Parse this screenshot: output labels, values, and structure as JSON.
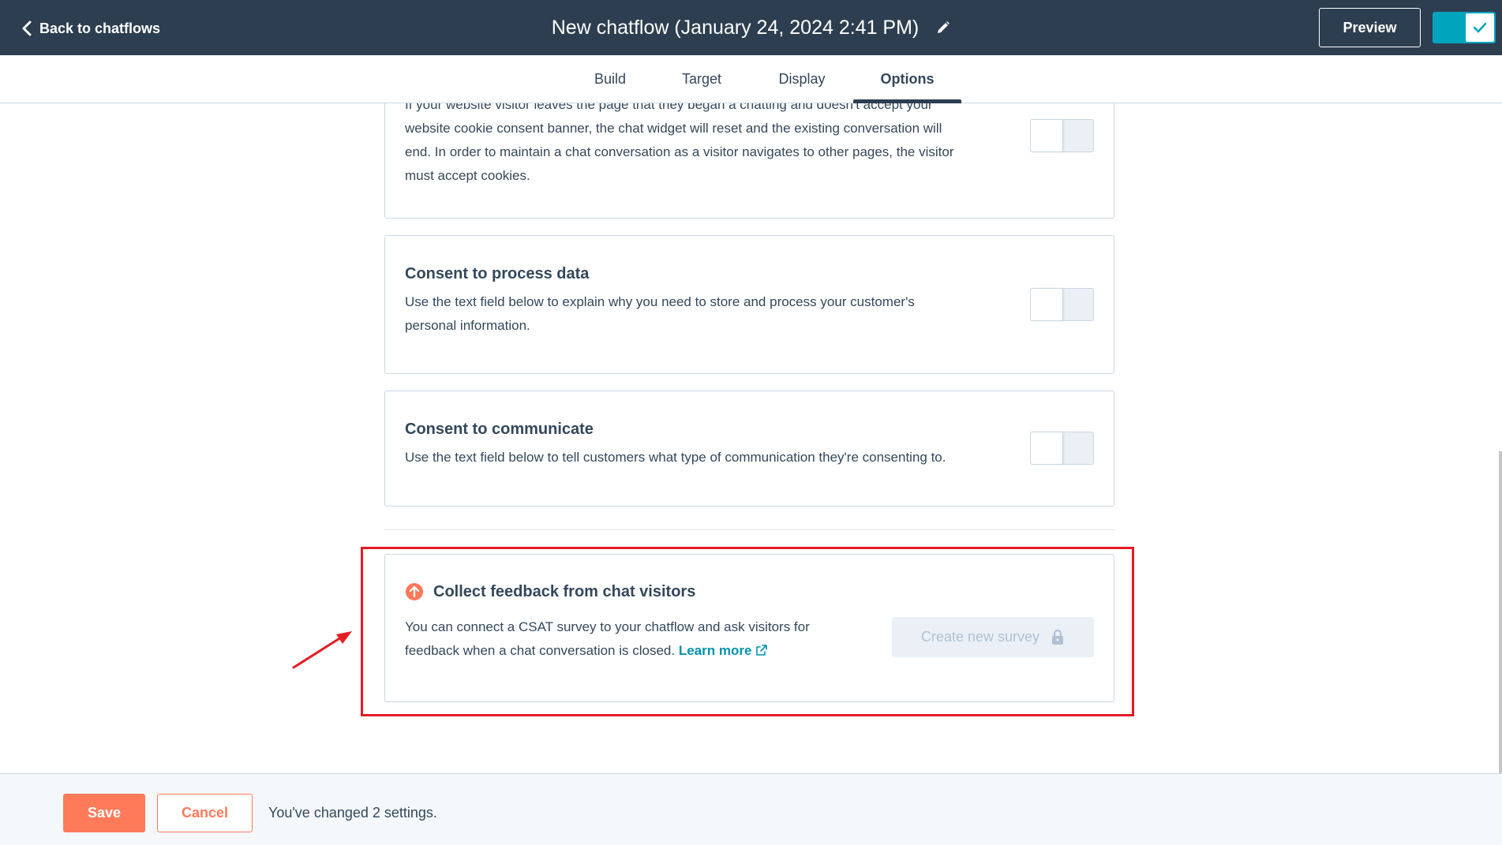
{
  "header": {
    "back_label": "Back to chatflows",
    "title": "New chatflow (January 24, 2024 2:41 PM)",
    "preview_label": "Preview"
  },
  "tabs": [
    {
      "label": "Build"
    },
    {
      "label": "Target"
    },
    {
      "label": "Display"
    },
    {
      "label": "Options",
      "active": true
    }
  ],
  "cards": {
    "cookie": {
      "partial_line": "If your website visitor leaves the page that they began a chatting and doesn't accept your",
      "text_lines": [
        "website cookie consent banner, the chat widget will reset and the existing conversation will",
        "end. In order to maintain a chat conversation as a visitor navigates to other pages, the visitor",
        "must accept cookies."
      ],
      "toggle_on": false
    },
    "process_data": {
      "title": "Consent to process data",
      "text_lines": [
        "Use the text field below to explain why you need to store and process your customer's",
        "personal information."
      ],
      "toggle_on": false
    },
    "communicate": {
      "title": "Consent to communicate",
      "text": "Use the text field below to tell customers what type of communication they're consenting to.",
      "toggle_on": false
    },
    "feedback": {
      "title": "Collect feedback from chat visitors",
      "text_line1": "You can connect a CSAT survey to your chatflow and ask visitors for",
      "text_line2": "feedback when a chat conversation is closed.",
      "learn_more": "Learn more",
      "button_label": "Create new survey"
    }
  },
  "footer": {
    "save_label": "Save",
    "cancel_label": "Cancel",
    "status": "You've changed 2 settings."
  },
  "colors": {
    "header_bg": "#2d3e50",
    "accent_teal": "#00a4bd",
    "save_orange": "#ff7a59",
    "annotation_red": "#e51c23",
    "link": "#0091ae"
  }
}
